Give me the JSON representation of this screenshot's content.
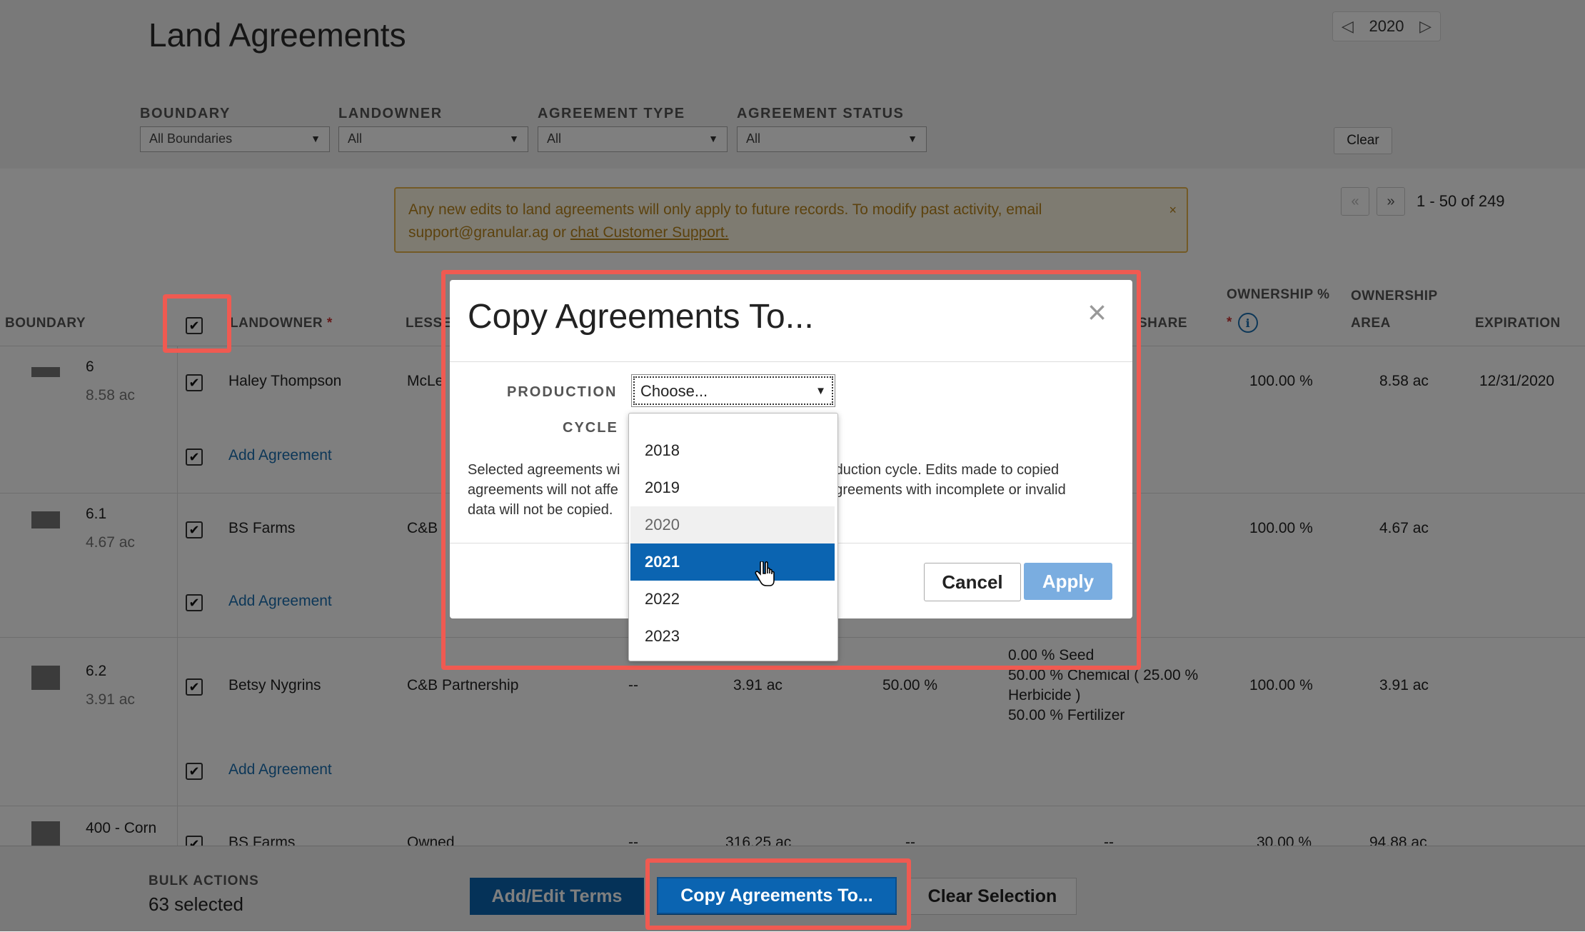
{
  "header": {
    "title": "Land Agreements",
    "year": "2020"
  },
  "filters": [
    {
      "label": "BOUNDARY",
      "value": "All Boundaries"
    },
    {
      "label": "LANDOWNER",
      "value": "All"
    },
    {
      "label": "AGREEMENT TYPE",
      "value": "All"
    },
    {
      "label": "AGREEMENT STATUS",
      "value": "All"
    }
  ],
  "clear_label": "Clear",
  "notice": {
    "text": "Any new edits to land agreements will only apply to future records. To modify past activity, email support@granular.ag or",
    "link": "chat Customer Support.",
    "close": "×"
  },
  "pager": {
    "prev": "«",
    "next": "»",
    "range": "1 - 50 of 249"
  },
  "table": {
    "headers": {
      "boundary": "BOUNDARY",
      "landowner": "LANDOWNER",
      "lessee": "LESSEE",
      "share": "SHARE",
      "ownership_pct_line1": "OWNERSHIP %",
      "ownership_area_line1": "OWNERSHIP",
      "ownership_area_line2": "AREA",
      "expiration": "EXPIRATION",
      "required_mark": "*"
    },
    "rows": [
      {
        "boundary": "6",
        "area": "8.58 ac",
        "landowner": "Haley Thompson",
        "lessee": "McLe",
        "ownership_pct": "100.00 %",
        "ownership_area": "8.58 ac",
        "expiration": "12/31/2020"
      },
      {
        "boundary": "6.1",
        "area": "4.67 ac",
        "landowner": "BS Farms",
        "lessee": "C&B",
        "ownership_pct": "100.00 %",
        "ownership_area": "4.67 ac",
        "expiration": ""
      },
      {
        "boundary": "6.2",
        "area": "3.91 ac",
        "landowner": "Betsy Nygrins",
        "lessee": "C&B Partnership",
        "col4": "--",
        "col5": "3.91 ac",
        "col6": "50.00 %",
        "share_lines": [
          "0.00 % Seed",
          "50.00 % Chemical ( 25.00 %",
          "Herbicide )",
          "50.00 % Fertilizer"
        ],
        "ownership_pct": "100.00 %",
        "ownership_area": "3.91 ac",
        "expiration": ""
      },
      {
        "boundary": "400 - Corn",
        "area": "",
        "landowner": "BS Farms",
        "lessee": "Owned",
        "col4": "--",
        "col5": "316.25 ac",
        "col6": "--",
        "col7": "--",
        "ownership_pct": "30.00 %",
        "ownership_area": "94.88 ac",
        "expiration": ""
      }
    ],
    "add_agreement": "Add Agreement"
  },
  "footer": {
    "bulk_label": "BULK ACTIONS",
    "count": "63 selected",
    "add_edit": "Add/Edit Terms",
    "copy": "Copy Agreements To...",
    "clear_selection": "Clear Selection"
  },
  "modal": {
    "title": "Copy Agreements To...",
    "close": "×",
    "production_label": "PRODUCTION",
    "cycle_label": "CYCLE",
    "select_value": "Choose...",
    "text_line1_a": "Selected agreements wi",
    "text_line1_b": "oduction cycle. Edits made to copied",
    "text_line2_a": "agreements will not affe",
    "text_line2_b": ": Agreements with incomplete or invalid",
    "text_line3": "data will not be copied.",
    "cancel": "Cancel",
    "apply": "Apply"
  },
  "dropdown": {
    "options": [
      "2018",
      "2019",
      "2020",
      "2021",
      "2022",
      "2023"
    ],
    "current": "2020",
    "selected": "2021"
  },
  "colors": {
    "highlight": "#f05a51",
    "primary": "#0b64b1",
    "apply_disabled": "#7aade0",
    "notice_text": "#b9851c"
  }
}
